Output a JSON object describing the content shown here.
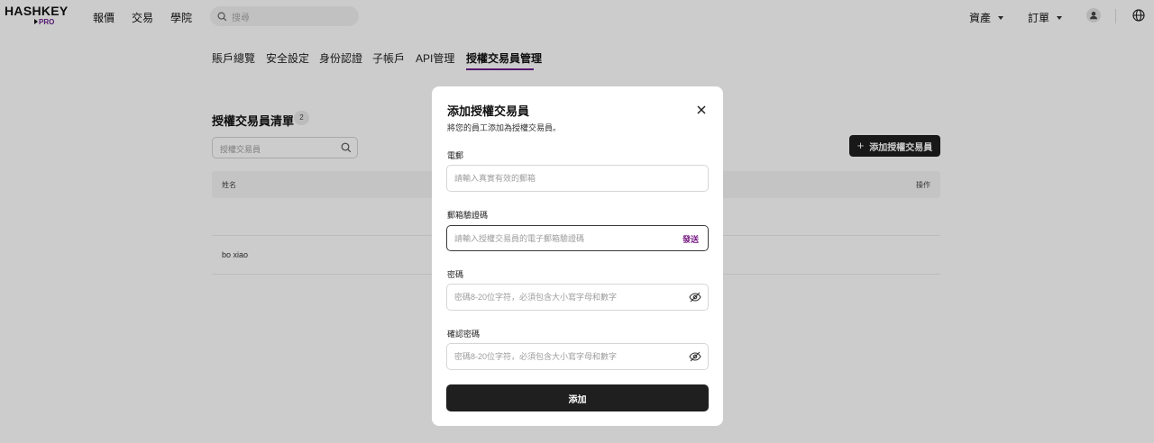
{
  "app": {
    "logo_main": "HASHKEY",
    "logo_sub": "PRO"
  },
  "topnav": {
    "links": [
      "報價",
      "交易",
      "學院"
    ],
    "search_placeholder": "搜尋",
    "assets_label": "資產",
    "orders_label": "訂單"
  },
  "tabs": [
    "賬戶總覽",
    "安全設定",
    "身份認證",
    "子帳戶",
    "API管理",
    "授權交易員管理"
  ],
  "page": {
    "list_title": "授權交易員清單",
    "count": "2",
    "search_placeholder": "授權交易員",
    "add_button": "添加授權交易員",
    "columns": {
      "name": "姓名",
      "action": "操作"
    },
    "rows": [
      {
        "name": "bo xiao"
      }
    ]
  },
  "modal": {
    "title": "添加授權交易員",
    "subtitle": "將您的員工添加為授權交易員。",
    "email_label": "電郵",
    "email_placeholder": "請輸入真實有效的郵箱",
    "code_label": "郵箱驗證碼",
    "code_placeholder": "請輸入授權交易員的電子郵箱驗證碼",
    "send_label": "發送",
    "password_label": "密碼",
    "password_placeholder": "密碼8-20位字符，必須包含大小寫字母和數字",
    "confirm_label": "確認密碼",
    "confirm_placeholder": "密碼8-20位字符，必須包含大小寫字母和數字",
    "submit_label": "添加"
  },
  "colors": {
    "accent": "#6b1f8c",
    "button_dark": "#1f1f1f"
  }
}
